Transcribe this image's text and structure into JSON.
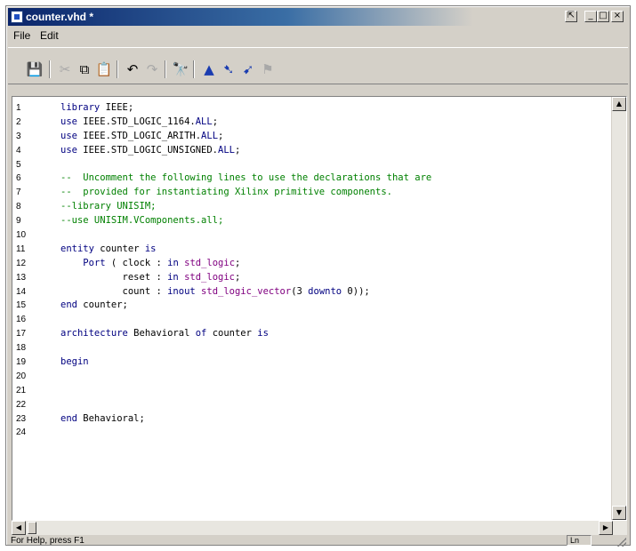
{
  "window": {
    "title": "counter.vhd *",
    "controls": {
      "restore": "⇱",
      "minimize": "_",
      "maximize": "□",
      "close": "×"
    }
  },
  "menu": [
    "File",
    "Edit"
  ],
  "toolbar": {
    "icons": [
      "save-icon",
      "cut-icon",
      "copy-icon",
      "paste-icon",
      "undo-icon",
      "redo-icon",
      "find-icon",
      "bookmark-toggle-icon",
      "bookmark-next-icon",
      "bookmark-prev-icon",
      "bookmark-clear-icon"
    ]
  },
  "editor": {
    "lines": [
      {
        "n": "1",
        "text": "library IEEE;",
        "kind": "kw"
      },
      {
        "n": "2",
        "text": "use IEEE.STD_LOGIC_1164.ALL;",
        "kind": "st"
      },
      {
        "n": "3",
        "text": "use IEEE.STD_LOGIC_ARITH.ALL;",
        "kind": "st"
      },
      {
        "n": "4",
        "text": "use IEEE.STD_LOGIC_UNSIGNED.ALL;",
        "kind": "st"
      },
      {
        "n": "5",
        "text": "",
        "kind": "st"
      },
      {
        "n": "6",
        "text": "--  Uncomment the following lines to use the declarations that are",
        "kind": "cm"
      },
      {
        "n": "7",
        "text": "--  provided for instantiating Xilinx primitive components.",
        "kind": "cm"
      },
      {
        "n": "8",
        "text": "--library UNISIM;",
        "kind": "cm"
      },
      {
        "n": "9",
        "text": "--use UNISIM.VComponents.all;",
        "kind": "cm"
      },
      {
        "n": "10",
        "text": "",
        "kind": "st"
      },
      {
        "n": "11",
        "text": "entity counter is",
        "kind": "st"
      },
      {
        "n": "12",
        "text": "    Port ( clock : in std_logic;",
        "kind": "st"
      },
      {
        "n": "13",
        "text": "           reset : in std_logic;",
        "kind": "st"
      },
      {
        "n": "14",
        "text": "           count : inout std_logic_vector(3 downto 0));",
        "kind": "st"
      },
      {
        "n": "15",
        "text": "end counter;",
        "kind": "st"
      },
      {
        "n": "16",
        "text": "",
        "kind": "st"
      },
      {
        "n": "17",
        "text": "architecture Behavioral of counter is",
        "kind": "st"
      },
      {
        "n": "18",
        "text": "",
        "kind": "st"
      },
      {
        "n": "19",
        "text": "begin",
        "kind": "st"
      },
      {
        "n": "20",
        "text": "",
        "kind": "st"
      },
      {
        "n": "21",
        "text": "",
        "kind": "st"
      },
      {
        "n": "22",
        "text": "",
        "kind": "st"
      },
      {
        "n": "23",
        "text": "end Behavioral;",
        "kind": "st"
      },
      {
        "n": "24",
        "text": "",
        "kind": "st"
      }
    ]
  },
  "statusbar": {
    "help_text": "For Help, press F1",
    "pane_text": "Ln"
  },
  "colors": {
    "keyword": "#000080",
    "comment": "#008000",
    "type": "#800080",
    "titlebar": "#0a246a"
  }
}
